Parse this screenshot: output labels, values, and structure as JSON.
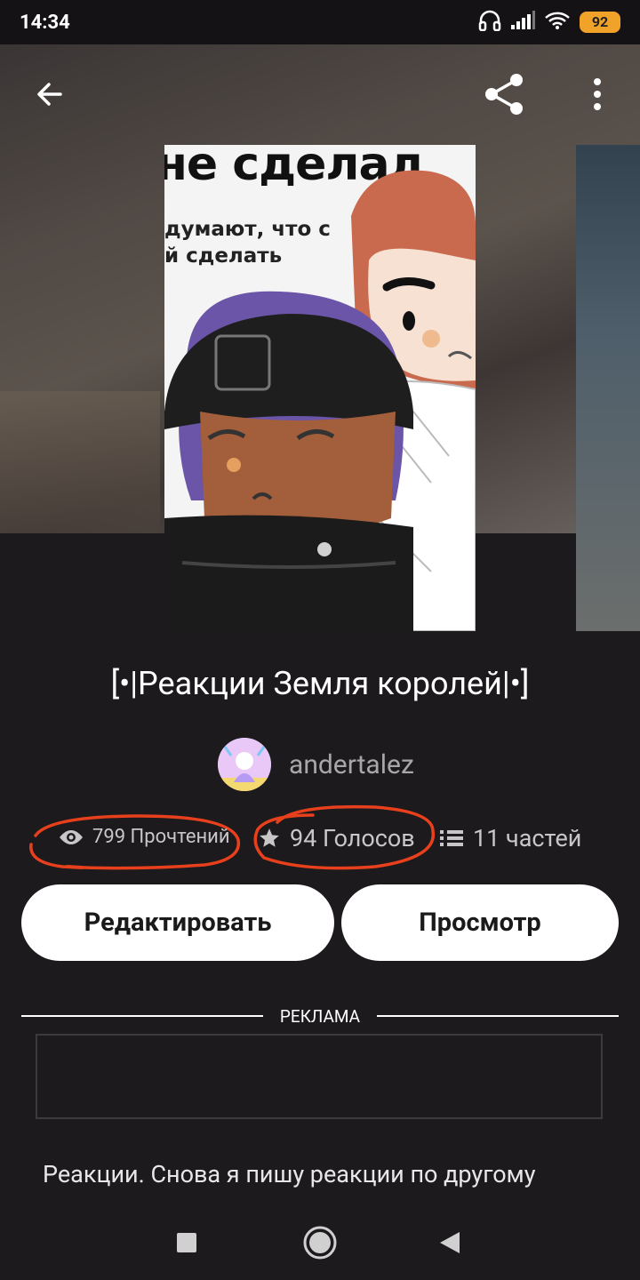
{
  "status_bar": {
    "time": "14:34",
    "battery": "92",
    "icons": [
      "headphones-icon",
      "signal-icon",
      "wifi-icon",
      "battery-icon"
    ]
  },
  "toolbar": {
    "back_icon": "arrow-left-icon",
    "share_icon": "share-icon",
    "more_icon": "more-vertical-icon"
  },
  "cover": {
    "text_line1": "не сделал",
    "text_line2": "думают, что с",
    "text_line3": "й сделать"
  },
  "story": {
    "title": "[•|Реакции Земля королей|•]",
    "author": "andertalez",
    "reads": "799 Прочтений",
    "votes": "94 Голосов",
    "parts": "11 частей",
    "description": "Реакции. Снова я пишу реакции по другому"
  },
  "actions": {
    "edit_label": "Редактировать",
    "preview_label": "Просмотр"
  },
  "ad": {
    "label": "РЕКЛАМА"
  },
  "colors": {
    "background": "#1c1a1c",
    "status_bar": "#141214",
    "battery": "#f0a229",
    "annotation_circle": "#e8401c",
    "button_bg": "#ffffff"
  }
}
